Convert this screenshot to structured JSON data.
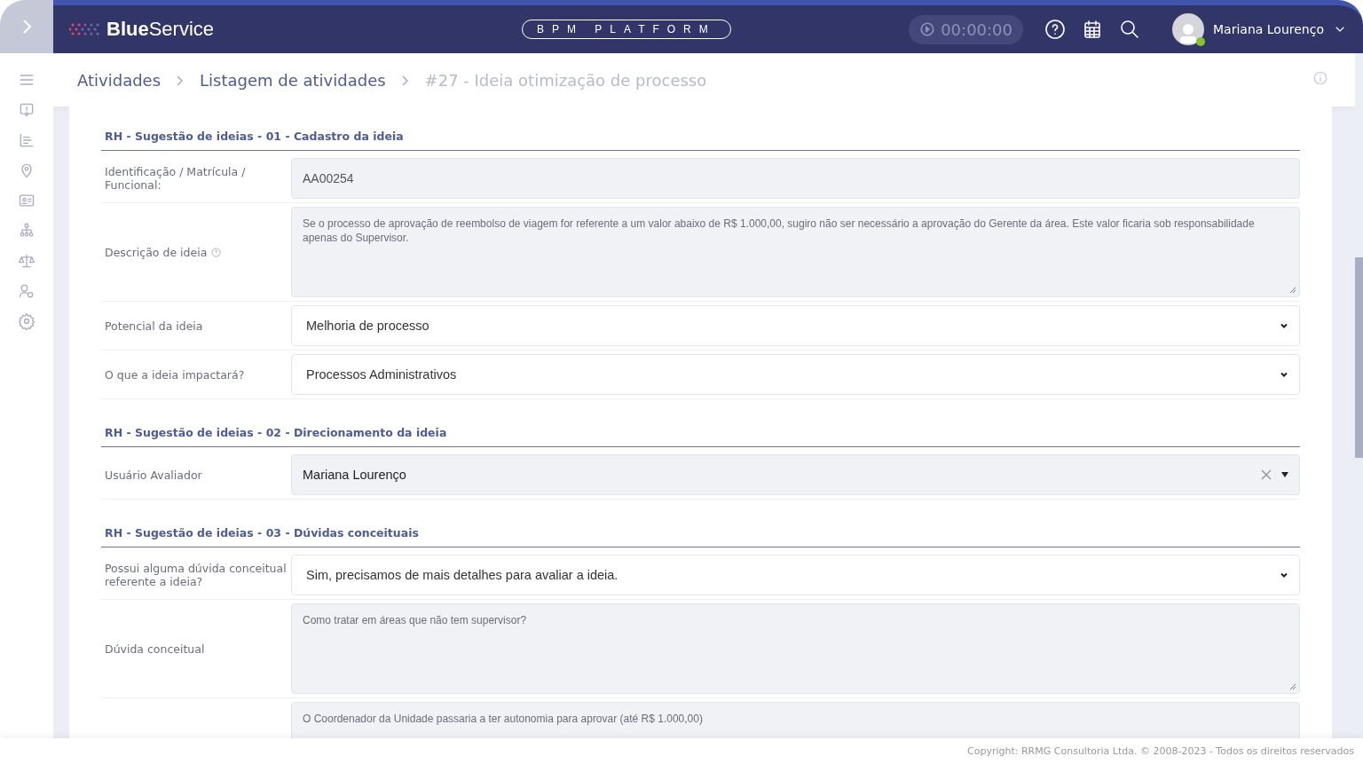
{
  "header": {
    "logo_bold": "Blue",
    "logo_light": "Service",
    "platform": "BPM PLATFORM",
    "timer": "00:00:00",
    "user": "Mariana Lourenço",
    "online": true
  },
  "breadcrumb": [
    {
      "label": "Atividades",
      "current": false
    },
    {
      "label": "Listagem de atividades",
      "current": false
    },
    {
      "label": "#27 - Ideia otimização de processo",
      "current": true
    }
  ],
  "sections": [
    {
      "title": "RH - Sugestão de ideias - 01 - Cadastro da ideia",
      "fields": [
        {
          "kind": "text",
          "label": "Identificação / Matrícula / Funcional:",
          "value": "AA00254"
        },
        {
          "kind": "textarea",
          "label": "Descrição de ideia",
          "help": true,
          "resize_handle": true,
          "value": "Se o processo de aprovação de reembolso de viagem for referente a um valor abaixo de R$ 1.000,00, sugiro não ser necessário a aprovação do Gerente da área. Este valor ficaria sob responsabilidade apenas do Supervisor."
        },
        {
          "kind": "select",
          "label": "Potencial da ideia",
          "value": "Melhoria de processo"
        },
        {
          "kind": "select",
          "label": "O que a ideia impactará?",
          "value": "Processos Administrativos"
        }
      ]
    },
    {
      "title": "RH - Sugestão de ideias - 02 - Direcionamento da ideia",
      "fields": [
        {
          "kind": "combo",
          "label": "Usuário Avaliador",
          "value": "Mariana Lourenço"
        }
      ]
    },
    {
      "title": "RH - Sugestão de ideias - 03 - Dúvidas conceituais",
      "fields": [
        {
          "kind": "select",
          "label": "Possui alguma dúvida conceitual referente a ideia?",
          "value": "Sim, precisamos de mais detalhes para avaliar a ideia."
        },
        {
          "kind": "textarea",
          "label": "Dúvida conceitual",
          "resize_handle": true,
          "value": "Como tratar em áreas que não tem supervisor?"
        },
        {
          "kind": "textarea",
          "value": "O Coordenador da Unidade passaria a ter autonomia para aprovar (até R$ 1.000,00)"
        }
      ]
    }
  ],
  "footer": "Copyright: RRMG Consultoria Ltda. © 2008-2023 - Todos os direitos reservados"
}
